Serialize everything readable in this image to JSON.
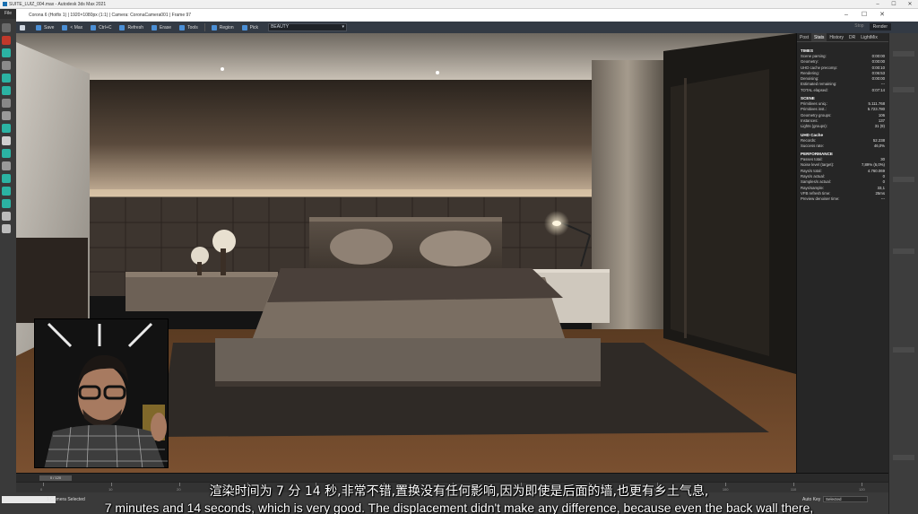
{
  "app": {
    "title": "SUITE_LUIZ_004.max - Autodesk 3ds Max 2021",
    "menu_file": "File"
  },
  "vfb": {
    "title": "Corona 6 (Hotfix 1) | 1920×1080px (1:1) | Camera: CoronaCamera001 | Frame 97",
    "toolbar": {
      "save": "Save",
      "max": "< Max",
      "ctrl_c": "Ctrl+C",
      "refresh": "Refresh",
      "erase": "Erase",
      "tools": "Tools",
      "region": "Region",
      "pick": "Pick",
      "render_element": "BEAUTY",
      "stop": "Stop",
      "render": "Render"
    }
  },
  "stats": {
    "tabs": [
      {
        "label": "Post",
        "active": false
      },
      {
        "label": "Stats",
        "active": true
      },
      {
        "label": "History",
        "active": false
      },
      {
        "label": "DR",
        "active": false
      },
      {
        "label": "LightMix",
        "active": false
      }
    ],
    "sections": [
      {
        "title": "TIMES",
        "rows": [
          {
            "label": "Scene parsing:",
            "value": "0:00:00"
          },
          {
            "label": "Geometry:",
            "value": "0:00:00"
          },
          {
            "label": "UHD cache precomp:",
            "value": "0:00:10"
          },
          {
            "label": "Rendering:",
            "value": "0:06:53"
          },
          {
            "label": "Denoising:",
            "value": "0:00:00"
          },
          {
            "label": "Estimated remaining:",
            "value": "---"
          },
          {
            "label": "TOTAL elapsed:",
            "value": "0:07:14"
          }
        ]
      },
      {
        "title": "SCENE",
        "rows": [
          {
            "label": "Primitives uniq.:",
            "value": "5.111.768"
          },
          {
            "label": "Primitives inst.:",
            "value": "5.723.780"
          },
          {
            "label": "Geometry groups:",
            "value": "106"
          },
          {
            "label": "Instances:",
            "value": "137"
          },
          {
            "label": "Lights (groups):",
            "value": "31 (9)"
          }
        ]
      },
      {
        "title": "UHD Cache",
        "rows": [
          {
            "label": "Records:",
            "value": "52.238"
          },
          {
            "label": "Success rate:",
            "value": "46,0%"
          }
        ]
      },
      {
        "title": "PERFORMANCE",
        "rows": [
          {
            "label": "Passes total:",
            "value": "30"
          },
          {
            "label": "Noise level (target):",
            "value": "7,89% (6,0%)"
          },
          {
            "label": "Rays/s total:",
            "value": "4.760.069"
          },
          {
            "label": "Rays/s actual:",
            "value": "0"
          },
          {
            "label": "Samples/s actual:",
            "value": "0"
          },
          {
            "label": "Rays/sample:",
            "value": "33,1"
          },
          {
            "label": "VFB refresh time:",
            "value": "25ms"
          },
          {
            "label": "Preview denoiser time:",
            "value": "---"
          }
        ]
      }
    ]
  },
  "timeline": {
    "slider": "0 / 120",
    "ruler_labels": [
      "0",
      "10",
      "20",
      "30",
      "40",
      "50",
      "60",
      "70",
      "80",
      "90",
      "100",
      "110",
      "120"
    ]
  },
  "status": {
    "selection": "1 Camera Selected",
    "auto_key": "Auto Key",
    "selected": "Selected"
  },
  "subtitles": {
    "zh": "渲染时间为 7 分 14 秒,非常不错,置换没有任何影响,因为即使是后面的墙,也更有乡土气息,",
    "en": "7 minutes and 14 seconds, which is very good. The displacement didn't make any difference, because even the back wall there,"
  },
  "colors": {
    "toolbar_bg": "#333a44",
    "accent_blue": "#4b8fd6",
    "panel_bg": "#262626"
  }
}
